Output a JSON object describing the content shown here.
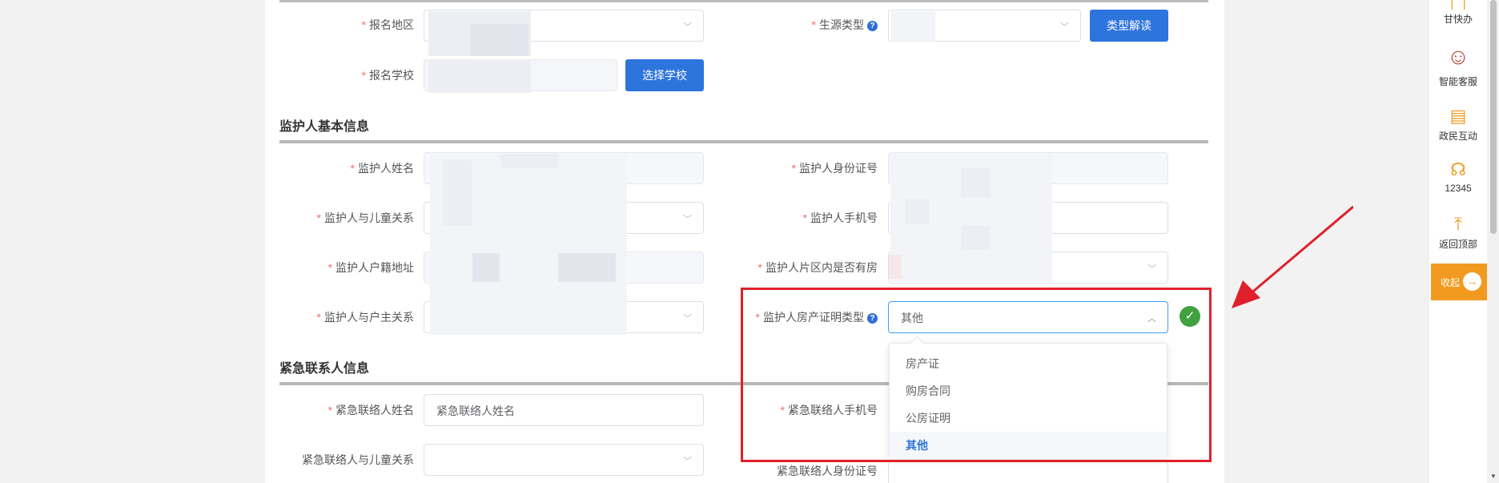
{
  "top_fields": {
    "region_label": "报名地区",
    "source_type_label": "生源类型",
    "type_explain_button": "类型解读",
    "school_label": "报名学校",
    "choose_school_button": "选择学校"
  },
  "guardian": {
    "section_title": "监护人基本信息",
    "name_label": "监护人姓名",
    "id_label": "监护人身份证号",
    "relation_child_label": "监护人与儿童关系",
    "phone_label": "监护人手机号",
    "hukou_address_label": "监护人户籍地址",
    "has_house_label": "监护人片区内是否有房",
    "relation_householder_label": "监护人与户主关系",
    "property_proof_label": "监护人房产证明类型",
    "property_proof_value": "其他"
  },
  "dropdown": {
    "options": [
      "房产证",
      "购房合同",
      "公房证明",
      "其他"
    ],
    "selected": "其他"
  },
  "emergency": {
    "section_title": "紧急联系人信息",
    "name_label": "紧急联络人姓名",
    "name_placeholder": "紧急联络人姓名",
    "phone_label": "紧急联络人手机号",
    "relation_label": "紧急联络人与儿童关系",
    "id_label": "紧急联络人身份证号"
  },
  "sidebar": {
    "items": [
      "甘快办",
      "智能客服",
      "政民互动",
      "12345",
      "返回顶部"
    ],
    "collapse_label": "收起"
  },
  "colors": {
    "primary": "#2e74dd",
    "required": "#f56c6c",
    "accent": "#f29a1f",
    "highlight": "#e0202a",
    "success": "#3fa23f"
  }
}
